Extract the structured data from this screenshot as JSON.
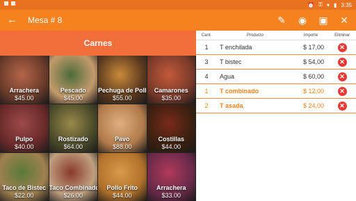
{
  "status": {
    "time": "3:35"
  },
  "appbar": {
    "title": "Mesa # 8"
  },
  "category": {
    "title": "Carnes"
  },
  "products": [
    {
      "name": "Arrachera",
      "price": "$45.00",
      "c1": "#6b3b2a",
      "c2": "#b5654a"
    },
    {
      "name": "Pescado",
      "price": "$45.00",
      "c1": "#c49a6c",
      "c2": "#4d6b3a"
    },
    {
      "name": "Pechuga de Pollo",
      "price": "$55.00",
      "c1": "#5c3a1e",
      "c2": "#c98a3a"
    },
    {
      "name": "Camarones",
      "price": "$35.00",
      "c1": "#7a3a2a",
      "c2": "#c25a3a"
    },
    {
      "name": "Pulpo",
      "price": "$40.00",
      "c1": "#6a2a2a",
      "c2": "#9e4a4a"
    },
    {
      "name": "Rostizado",
      "price": "$64.00",
      "c1": "#4a4a2a",
      "c2": "#9a8a4a"
    },
    {
      "name": "Pavo",
      "price": "$88.00",
      "c1": "#b07a4a",
      "c2": "#e0b080"
    },
    {
      "name": "Costillas",
      "price": "$44.00",
      "c1": "#3a2010",
      "c2": "#7a2a1a"
    },
    {
      "name": "Taco de Bistec",
      "price": "$22.00",
      "c1": "#a08050",
      "c2": "#5a7a3a"
    },
    {
      "name": "Taco Combinado",
      "price": "$26.00",
      "c1": "#c0a080",
      "c2": "#8a3a2a"
    },
    {
      "name": "Pollo Frito",
      "price": "$44.00",
      "c1": "#b0702a",
      "c2": "#d89a4a"
    },
    {
      "name": "Arrachera",
      "price": "$33.00",
      "c1": "#6a2a4a",
      "c2": "#b03a5a"
    }
  ],
  "order": {
    "headers": {
      "cant": "Cant.",
      "producto": "Producto",
      "importe": "Importe",
      "eliminar": "Eliminar"
    },
    "rows": [
      {
        "cant": "1",
        "producto": "T enchilada",
        "importe": "$ 17,00",
        "highlight": false
      },
      {
        "cant": "3",
        "producto": "T bistec",
        "importe": "$ 54,00",
        "highlight": false
      },
      {
        "cant": "4",
        "producto": "Agua",
        "importe": "$ 60,00",
        "highlight": false
      },
      {
        "cant": "1",
        "producto": "T combinado",
        "importe": "$ 12,00",
        "highlight": true
      },
      {
        "cant": "2",
        "producto": "T asada",
        "importe": "$ 24,00",
        "highlight": true
      }
    ]
  },
  "colors": {
    "primary": "#f5821f",
    "category": "#f26e3b",
    "delete": "#e53935"
  }
}
